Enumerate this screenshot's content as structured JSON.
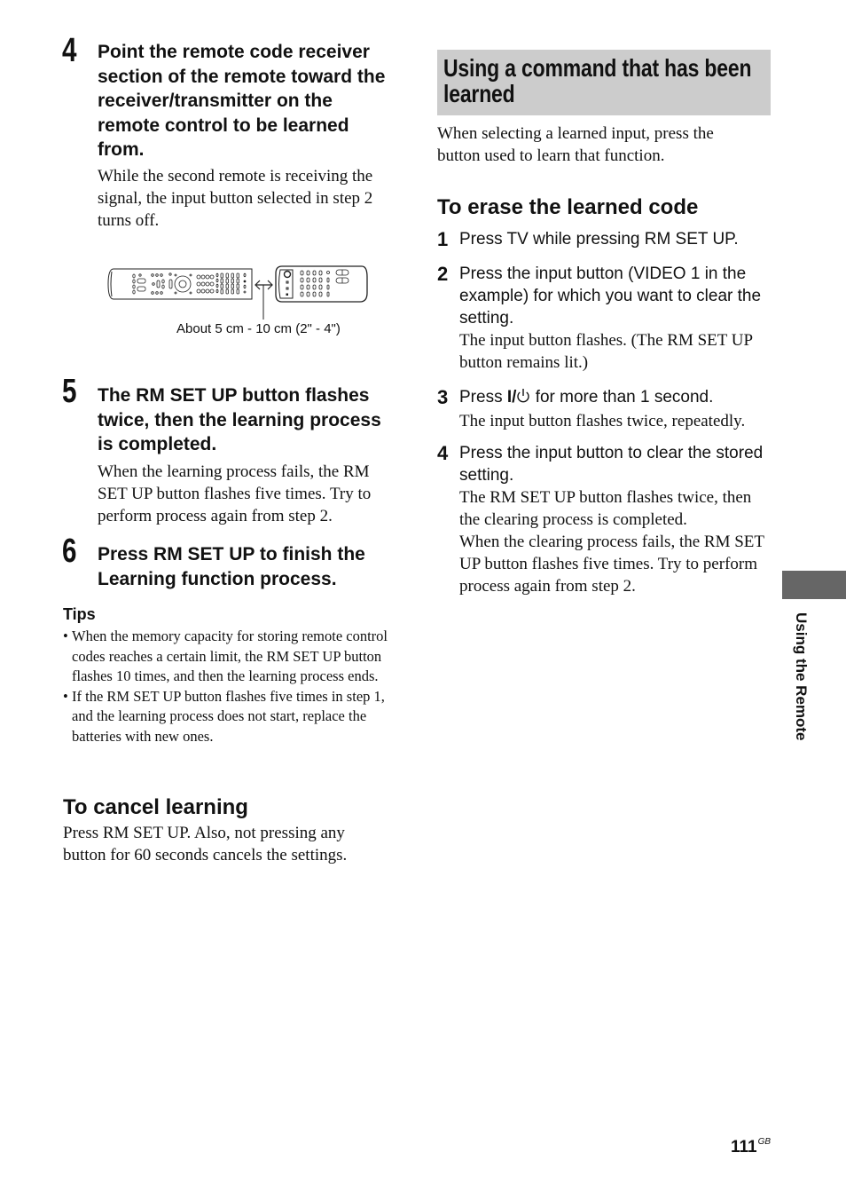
{
  "left_column": {
    "step4": {
      "number": "4",
      "heading": "Point the remote code receiver section of the remote toward the receiver/transmitter on the remote control to be learned from.",
      "body": "While the second remote is receiving the signal, the input button selected in step 2 turns off."
    },
    "figure": {
      "caption": "About 5 cm - 10 cm (2\" - 4\")",
      "left_object": "remote-control-icon",
      "right_object": "receiver-transmitter-remote-icon",
      "connector": "double-arrow-icon"
    },
    "step5": {
      "number": "5",
      "heading": "The RM SET UP button flashes twice, then the learning process is completed.",
      "body": "When the learning process fails, the RM SET UP button flashes five times. Try to perform process again from step 2."
    },
    "step6": {
      "number": "6",
      "heading": "Press RM SET UP to finish the Learning function process."
    },
    "tips": {
      "heading": "Tips",
      "bullet": "•",
      "items": [
        "When the memory capacity for storing remote control codes reaches a certain limit, the RM SET UP button flashes 10 times, and then the learning process ends.",
        "If the RM SET UP button flashes five times in step 1, and the learning process does not start, replace the batteries with new ones."
      ]
    },
    "cancel": {
      "heading": "To cancel learning",
      "body": "Press RM SET UP. Also, not pressing any button for 60 seconds cancels the settings."
    }
  },
  "right_column": {
    "section": {
      "title": "Using a command that has been learned",
      "background": "#cccccc",
      "body": "When selecting a learned input, press the button used to learn that function."
    },
    "erase": {
      "heading": "To erase the learned code",
      "steps": [
        {
          "number": "1",
          "main": "Press TV while pressing RM SET UP.",
          "note": ""
        },
        {
          "number": "2",
          "main": "Press the input button (VIDEO 1 in the example) for which you want to clear the setting.",
          "note": "The input button flashes. (The RM SET UP button remains lit.)"
        },
        {
          "number": "3",
          "main_before": "Press ",
          "main_symbol": "I/",
          "main_icon": "power-icon",
          "main_after": " for more than 1 second.",
          "note": "The input button flashes twice, repeatedly."
        },
        {
          "number": "4",
          "main": "Press the input button to clear the stored setting.",
          "note": "The RM SET UP button flashes twice, then the clearing process is completed.",
          "note2": "When the clearing process fails, the RM SET UP button flashes five times. Try to perform process again from step 2."
        }
      ]
    }
  },
  "side_tab": {
    "label": "Using the Remote",
    "color": "#666666"
  },
  "footer": {
    "page_number": "111",
    "suffix": "GB"
  }
}
